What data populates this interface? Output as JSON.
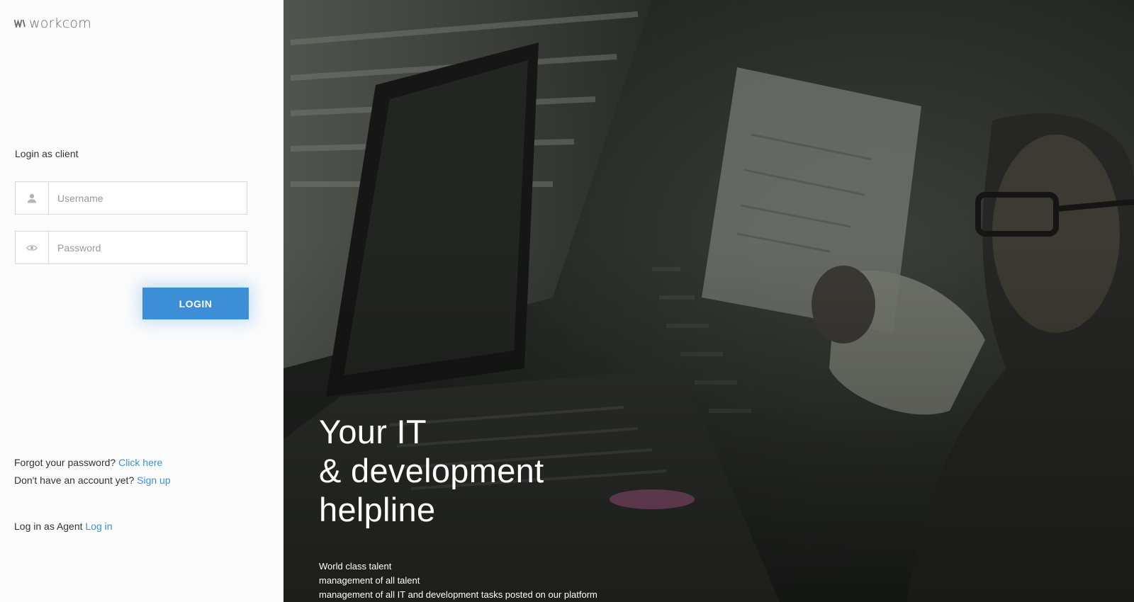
{
  "brand": {
    "name": "workcom",
    "logo_icon": "workcom-logo-mark",
    "accent_color": "#3c8fd6"
  },
  "login": {
    "heading": "Login as client",
    "username": {
      "placeholder": "Username",
      "value": "",
      "icon": "user-icon"
    },
    "password": {
      "placeholder": "Password",
      "value": "",
      "icon": "eye-icon"
    },
    "submit_label": "LOGIN"
  },
  "links": {
    "forgot_text": "Forgot your password?",
    "forgot_link": "Click here",
    "signup_text": "Don't have an account yet?",
    "signup_link": "Sign up",
    "agent_text": "Log in as Agent",
    "agent_link": "Log in"
  },
  "hero": {
    "title_lines": [
      "Your IT",
      "& development",
      "helpline"
    ],
    "description_lines": [
      "World class talent",
      "management of all talent",
      "management of all IT and development tasks posted on our platform"
    ]
  }
}
